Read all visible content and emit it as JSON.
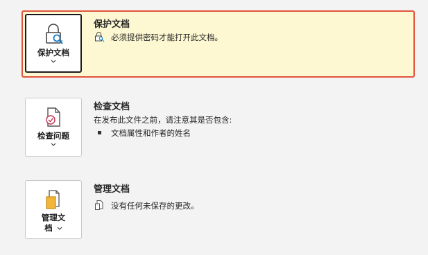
{
  "protect": {
    "tile_label": "保护文档",
    "title": "保护文档",
    "description": "必须提供密码才能打开此文档。"
  },
  "inspect": {
    "tile_label": "检查问题",
    "title": "检查文档",
    "description": "在发布此文件之前，请注意其是否包含:",
    "items": [
      "文档属性和作者的姓名"
    ]
  },
  "manage": {
    "tile_label_line1": "管理文",
    "tile_label_line2": "档",
    "title": "管理文档",
    "description": "没有任何未保存的更改。"
  },
  "colors": {
    "highlight_bg": "#fdf8d2",
    "highlight_border": "#e0533a",
    "page_bg": "#f3f3f3"
  },
  "icons": {
    "protect": "lock-key-icon",
    "inspect": "document-check-icon",
    "manage": "document-manage-icon"
  }
}
